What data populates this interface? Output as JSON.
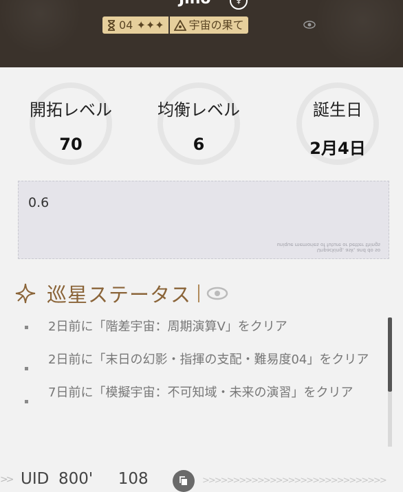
{
  "header": {
    "player_name": "Jino",
    "gender_symbol": "♀",
    "tag_level": "04 ✦✦✦",
    "tag_universe": "宇宙の果て"
  },
  "stats": [
    {
      "label": "開拓レベル",
      "value": "70"
    },
    {
      "label": "均衡レベル",
      "value": "6"
    },
    {
      "label": "誕生日",
      "value": "2月4日"
    }
  ],
  "signature": {
    "text": "0.6",
    "watermark": "Unpacking, ask, and do so\nunique memories of future or better things"
  },
  "status_section": {
    "title": "巡星ステータス",
    "items": [
      "2日前に「階差宇宙：周期演算V」をクリア",
      "2日前に「末日の幻影・指揮の支配・難易度04」をクリア",
      "7日前に「模擬宇宙：不可知域・未来の演習」をクリア"
    ]
  },
  "footer": {
    "uid_label": "UID",
    "uid_value": "800'     108",
    "left_chevrons": ">>",
    "right_chevrons": ">>>>>>>>>>>>>>>>>>>>>>>>>>>>>>"
  }
}
